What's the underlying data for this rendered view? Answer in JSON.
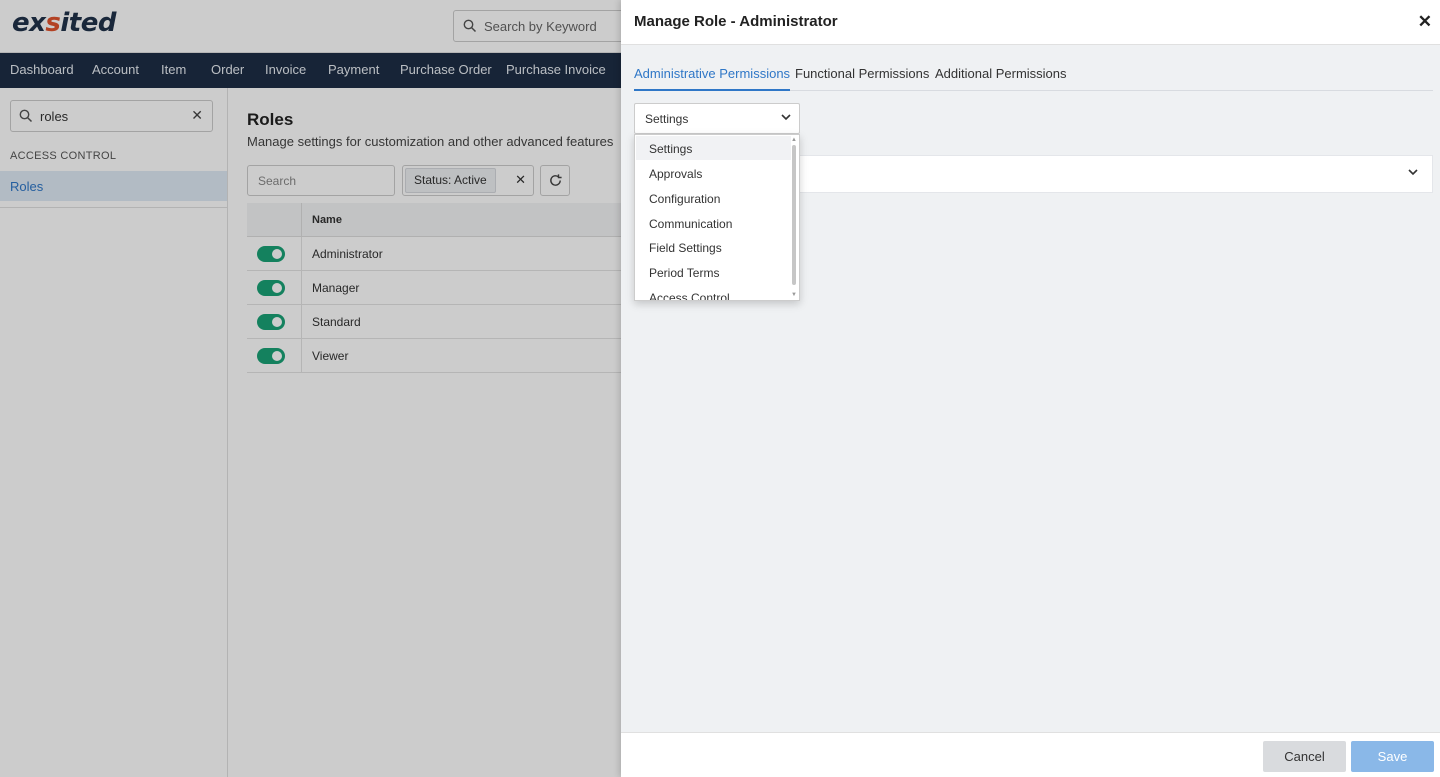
{
  "app": {
    "logo_text": "exsited",
    "keyword_search_placeholder": "Search by Keyword"
  },
  "nav": {
    "items": [
      "Dashboard",
      "Account",
      "Item",
      "Order",
      "Invoice",
      "Payment",
      "Purchase Order",
      "Purchase Invoice"
    ]
  },
  "sidebar": {
    "search_value": "roles",
    "section_title": "ACCESS CONTROL",
    "active_item": "Roles"
  },
  "main": {
    "title": "Roles",
    "subtitle": "Manage settings for customization and other advanced features",
    "search_placeholder": "Search",
    "status_filter": "Status: Active",
    "column_name": "Name",
    "rows": [
      {
        "name": "Administrator",
        "active": true
      },
      {
        "name": "Manager",
        "active": true
      },
      {
        "name": "Standard",
        "active": true
      },
      {
        "name": "Viewer",
        "active": true
      }
    ]
  },
  "drawer": {
    "title": "Manage Role - Administrator",
    "close_glyph": "✕",
    "tabs": [
      "Administrative Permissions",
      "Functional Permissions",
      "Additional Permissions"
    ],
    "active_tab": "Administrative Permissions",
    "select_value": "Settings",
    "dropdown_options": [
      "Settings",
      "Approvals",
      "Configuration",
      "Communication",
      "Field Settings",
      "Period Terms",
      "Access Control"
    ],
    "cancel_label": "Cancel",
    "save_label": "Save"
  },
  "colors": {
    "nav_bg": "#1d2e45",
    "accent": "#2f77c7",
    "toggle_on": "#1aa276",
    "save_button": "#8ab8e8",
    "logo_accent": "#e0532e"
  }
}
